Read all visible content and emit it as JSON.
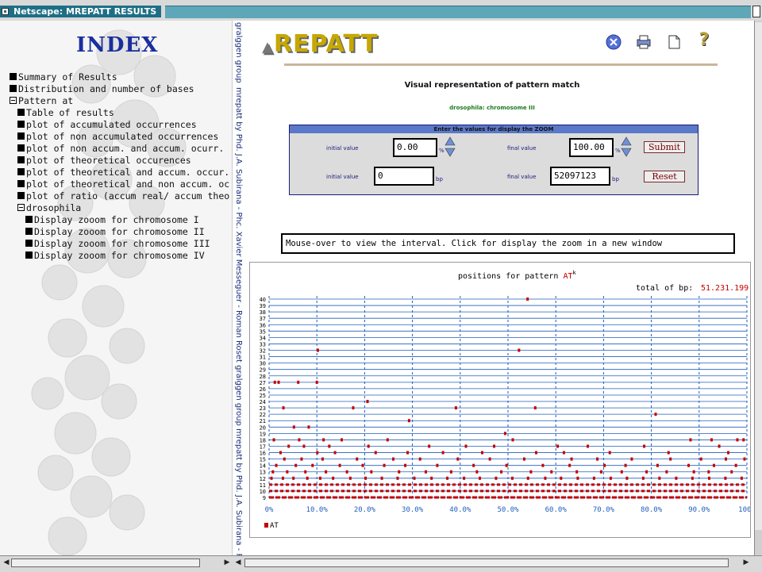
{
  "window": {
    "title": "Netscape: MREPATT RESULTS"
  },
  "index": {
    "title": "INDEX",
    "items": [
      {
        "label": "Summary of Results",
        "level": 0,
        "type": "leaf"
      },
      {
        "label": "Distribution and number of bases",
        "level": 0,
        "type": "leaf"
      },
      {
        "label": "Pattern at",
        "level": 0,
        "type": "open"
      },
      {
        "label": "Table of results",
        "level": 1,
        "type": "leaf"
      },
      {
        "label": "plot of accumulated occurrences",
        "level": 1,
        "type": "leaf"
      },
      {
        "label": "plot of non accumulated occurrences",
        "level": 1,
        "type": "leaf"
      },
      {
        "label": "plot of non accum. and accum. ocurr.",
        "level": 1,
        "type": "leaf"
      },
      {
        "label": "plot of theoretical occurences",
        "level": 1,
        "type": "leaf"
      },
      {
        "label": "plot of theoretical and accum. occur.",
        "level": 1,
        "type": "leaf"
      },
      {
        "label": "plot of theoretical and non accum. oc",
        "level": 1,
        "type": "leaf"
      },
      {
        "label": "plot of ratio (accum real/ accum theo",
        "level": 1,
        "type": "leaf"
      },
      {
        "label": "drosophila",
        "level": 1,
        "type": "open"
      },
      {
        "label": "Display zooom for chromosome I",
        "level": 2,
        "type": "leaf"
      },
      {
        "label": "Display zooom for chromosome II",
        "level": 2,
        "type": "leaf"
      },
      {
        "label": "Display zooom for chromosome III",
        "level": 2,
        "type": "leaf"
      },
      {
        "label": "Display zooom for chromosome IV",
        "level": 2,
        "type": "leaf"
      }
    ]
  },
  "divider": {
    "text": "mrepatt by Phd. J.A. Subirana - Phc. Xavier Messeguer - Roman Roset  gralggen group  mrepatt by Phd. J.A. Subirana - Phc"
  },
  "divider_top": {
    "text": "gralggen group"
  },
  "header": {
    "logo": "REPATT",
    "icons": [
      "close-icon",
      "print-icon",
      "document-icon",
      "help-icon"
    ],
    "question_mark": "?",
    "heading": "Visual representation of pattern match",
    "subheading": "drosophila: chromosome III"
  },
  "zoom_form": {
    "header": "Enter the values for display the ZOOM",
    "initial_label": "initial value",
    "final_label": "final value",
    "initial_percent": "0.00",
    "final_percent": "100.00",
    "percent_unit": "%",
    "initial_bp": "0",
    "final_bp": "52097123",
    "bp_unit": "bp",
    "submit_label": "Submit",
    "reset_label": "Reset"
  },
  "info": {
    "text": "Mouse-over to view the interval. Click for display the zoom in a new window"
  },
  "colors": {
    "accent": "#c40000",
    "axis_blue": "#1f5fbf",
    "form_header": "#5a79c8"
  },
  "chart_data": {
    "type": "scatter",
    "title": "positions for pattern AT",
    "title_sup": "k",
    "title_series": "AT",
    "total_label": "total of bp:",
    "total_value": "51.231.199",
    "x_ticks": [
      "0%",
      "10.0%",
      "20.0%",
      "30.0%",
      "40.0%",
      "50.0%",
      "60.0%",
      "70.0%",
      "80.0%",
      "90.0%",
      "100%"
    ],
    "xlim": [
      0,
      100
    ],
    "y_ticks": [
      40,
      39,
      38,
      37,
      36,
      35,
      34,
      33,
      32,
      31,
      30,
      29,
      28,
      27,
      26,
      25,
      24,
      23,
      22,
      21,
      20,
      19,
      18,
      17,
      16,
      15,
      14,
      13,
      12,
      11,
      10,
      9
    ],
    "ylim": [
      9,
      40
    ],
    "legend": "AT",
    "series": [
      {
        "k": 40,
        "x": [
          54.1
        ]
      },
      {
        "k": 32,
        "x": [
          10.2,
          52.3
        ]
      },
      {
        "k": 27,
        "x": [
          1.2,
          2.0,
          6.1,
          10.0
        ]
      },
      {
        "k": 24,
        "x": [
          20.6
        ]
      },
      {
        "k": 23,
        "x": [
          3.0,
          17.6,
          39.1,
          55.7
        ]
      },
      {
        "k": 22,
        "x": [
          80.9
        ]
      },
      {
        "k": 21,
        "x": [
          29.3
        ]
      },
      {
        "k": 20,
        "x": [
          5.2,
          8.3
        ]
      },
      {
        "k": 19,
        "x": [
          49.4
        ]
      },
      {
        "k": 18,
        "x": [
          1.0,
          6.3,
          11.4,
          15.2,
          24.8,
          51.0,
          88.2,
          92.6,
          98.0,
          99.3
        ]
      },
      {
        "k": 17,
        "x": [
          4.1,
          7.3,
          12.6,
          20.8,
          33.5,
          41.2,
          47.1,
          60.4,
          66.7,
          78.5,
          94.2
        ]
      },
      {
        "k": 16,
        "x": [
          2.4,
          10.1,
          13.8,
          22.3,
          29.0,
          36.4,
          44.6,
          55.9,
          61.7,
          71.3,
          83.6,
          96.1
        ]
      },
      {
        "k": 15,
        "x": [
          3.2,
          6.8,
          11.2,
          18.4,
          26.0,
          31.6,
          39.5,
          46.2,
          53.4,
          63.3,
          68.7,
          75.9,
          84.0,
          90.4,
          95.6,
          99.5
        ]
      },
      {
        "k": 14,
        "x": [
          1.5,
          5.6,
          9.1,
          14.8,
          19.6,
          24.1,
          28.5,
          35.2,
          42.8,
          49.7,
          57.3,
          62.9,
          70.2,
          74.6,
          81.3,
          87.8,
          93.1,
          97.7
        ]
      },
      {
        "k": 13,
        "x": [
          0.8,
          3.8,
          7.6,
          11.9,
          16.3,
          21.4,
          27.2,
          32.8,
          38.1,
          43.5,
          48.6,
          54.8,
          59.1,
          64.4,
          69.5,
          73.8,
          79.0,
          83.2,
          88.9,
          92.0,
          96.8
        ]
      },
      {
        "k": 12,
        "x": [
          0.5,
          2.9,
          5.1,
          8.0,
          10.7,
          13.4,
          17.0,
          20.2,
          23.6,
          26.9,
          30.4,
          34.0,
          37.3,
          40.8,
          44.1,
          47.5,
          50.9,
          54.2,
          57.8,
          61.1,
          64.6,
          68.0,
          71.5,
          74.9,
          78.3,
          81.7,
          85.2,
          88.6,
          92.1,
          95.5,
          98.9
        ]
      }
    ]
  }
}
